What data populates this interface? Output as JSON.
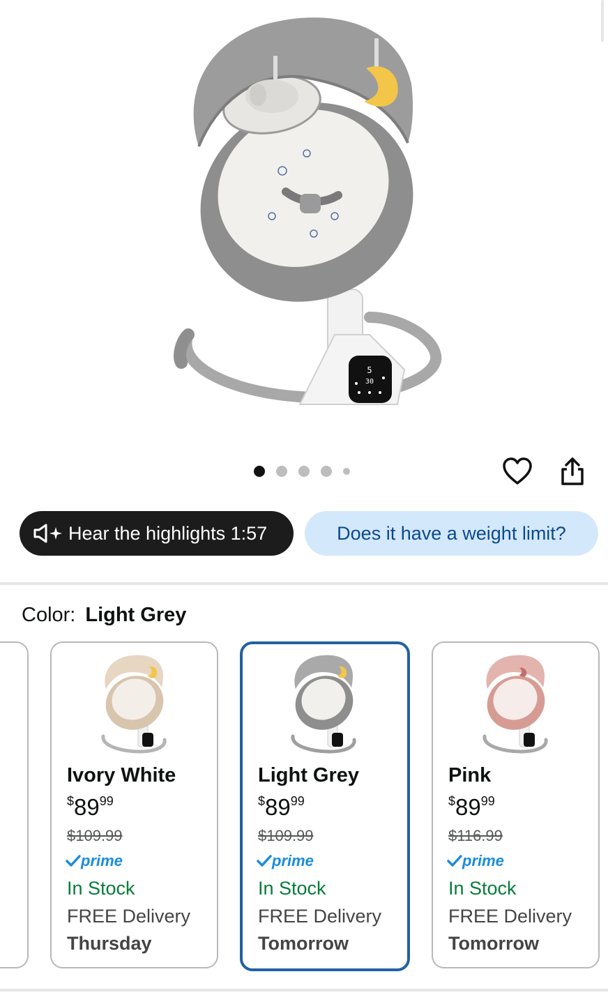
{
  "gallery": {
    "dot_count": 5,
    "active_index": 0
  },
  "actions": {
    "hear_label": "Hear the highlights 1:57",
    "question_label": "Does it have a weight limit?"
  },
  "color": {
    "label": "Color:",
    "selected": "Light Grey"
  },
  "variants": [
    {
      "name": "Ivory White",
      "price_whole": "89",
      "price_fraction": "99",
      "currency": "$",
      "list_price": "$109.99",
      "prime": "prime",
      "stock": "In Stock",
      "delivery": "FREE Delivery",
      "day": "Thursday",
      "selected": false,
      "color_hex": "#e6d6c2"
    },
    {
      "name": "Light Grey",
      "price_whole": "89",
      "price_fraction": "99",
      "currency": "$",
      "list_price": "$109.99",
      "prime": "prime",
      "stock": "In Stock",
      "delivery": "FREE Delivery",
      "day": "Tomorrow",
      "selected": true,
      "color_hex": "#a9a9a9"
    },
    {
      "name": "Pink",
      "price_whole": "89",
      "price_fraction": "99",
      "currency": "$",
      "list_price": "$116.99",
      "prime": "prime",
      "stock": "In Stock",
      "delivery": "FREE Delivery",
      "day": "Tomorrow",
      "selected": false,
      "color_hex": "#e3b3ad"
    }
  ],
  "colors": {
    "selected_border": "#2162a1",
    "in_stock": "#067d3a",
    "prime_blue": "#1a8cdc",
    "pill_light_bg": "#d4e8fc",
    "pill_dark_bg": "#1c1c1c"
  }
}
